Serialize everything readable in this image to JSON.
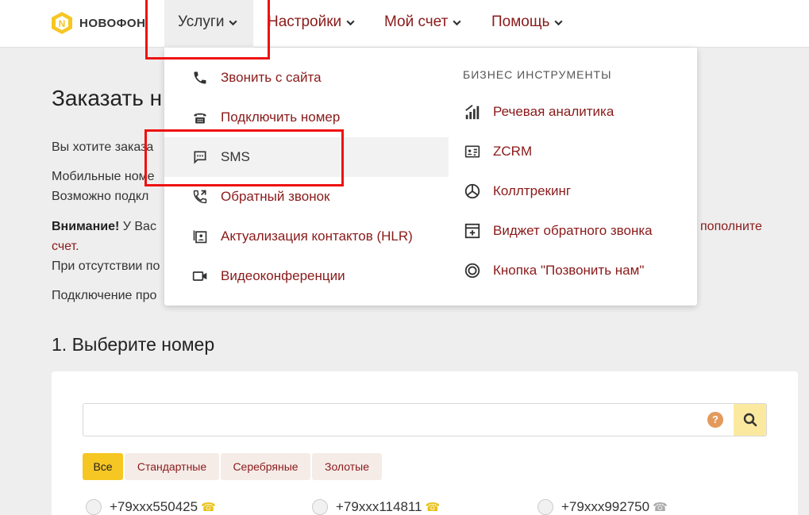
{
  "header": {
    "logo_text": "НОВОФОН",
    "nav": [
      {
        "label": "Услуги",
        "active": true
      },
      {
        "label": "Настройки"
      },
      {
        "label": "Мой счет"
      },
      {
        "label": "Помощь"
      }
    ]
  },
  "page": {
    "title": "Заказать н",
    "para1": "Вы хотите заказа",
    "para2a": "Мобильные номе",
    "para2b": "Возможно подкл",
    "warning_bold": "Внимание!",
    "warning_text": " У Вас",
    "warning_link": "пополните",
    "warning_link2": "счет.",
    "para3": "При отсутствии по",
    "para4": "Подключение про",
    "section_title": "1. Выберите номер"
  },
  "search": {
    "placeholder": "",
    "value": "",
    "help": "?"
  },
  "filters": [
    {
      "label": "Все",
      "selected": true
    },
    {
      "label": "Стандартные"
    },
    {
      "label": "Серебряные"
    },
    {
      "label": "Золотые"
    }
  ],
  "numbers": [
    {
      "number": "+79xxx550425",
      "icon": "phone-gold-icon",
      "color": "#e8c21a"
    },
    {
      "number": "+79xxx114811",
      "icon": "phone-gold-icon",
      "color": "#e8c21a"
    },
    {
      "number": "+79xxx992750",
      "icon": "phone-silver-icon",
      "color": "#aaaaaa"
    }
  ],
  "dropdown": {
    "left_items": [
      {
        "label": "Звонить с сайта",
        "icon": "phone-icon"
      },
      {
        "label": "Подключить номер",
        "icon": "desk-phone-icon"
      },
      {
        "label": "SMS",
        "icon": "sms-icon"
      },
      {
        "label": "Обратный звонок",
        "icon": "callback-icon"
      },
      {
        "label": "Актуализация контактов (HLR)",
        "icon": "contacts-icon"
      },
      {
        "label": "Видеоконференции",
        "icon": "video-icon"
      }
    ],
    "right_heading": "БИЗНЕС ИНСТРУМЕНТЫ",
    "right_items": [
      {
        "label": "Речевая аналитика",
        "icon": "analytics-icon"
      },
      {
        "label": "ZCRM",
        "icon": "crm-icon"
      },
      {
        "label": "Коллтрекинг",
        "icon": "calltracking-icon"
      },
      {
        "label": "Виджет обратного звонка",
        "icon": "widget-icon"
      },
      {
        "label": "Кнопка \"Позвонить нам\"",
        "icon": "call-button-icon"
      }
    ]
  },
  "colors": {
    "accent": "#8a1a1a",
    "brand_yellow": "#f6c623",
    "highlight": "#ee1111"
  }
}
